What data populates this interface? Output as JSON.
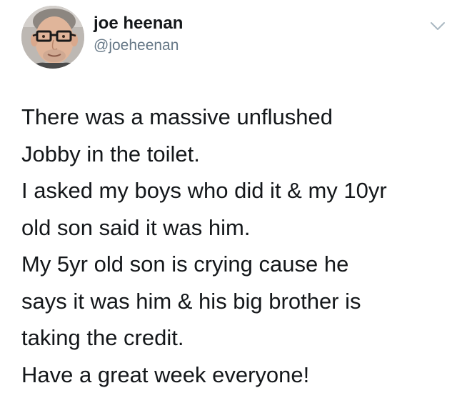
{
  "author": {
    "display_name": "joe heenan",
    "handle": "@joeheenan",
    "avatar_icon": "profile-photo",
    "menu_icon": "chevron-down-icon"
  },
  "tweet": {
    "lines": [
      "There was a massive unflushed",
      "Jobby in the toilet.",
      "I asked my boys who did it & my 10yr",
      "old son said it was him.",
      "My 5yr old son is crying cause he",
      "says it was him & his big brother is",
      "taking the credit.",
      "Have a great week everyone!"
    ]
  },
  "colors": {
    "text": "#14171a",
    "secondary": "#657786",
    "icon": "#aab8c2"
  }
}
